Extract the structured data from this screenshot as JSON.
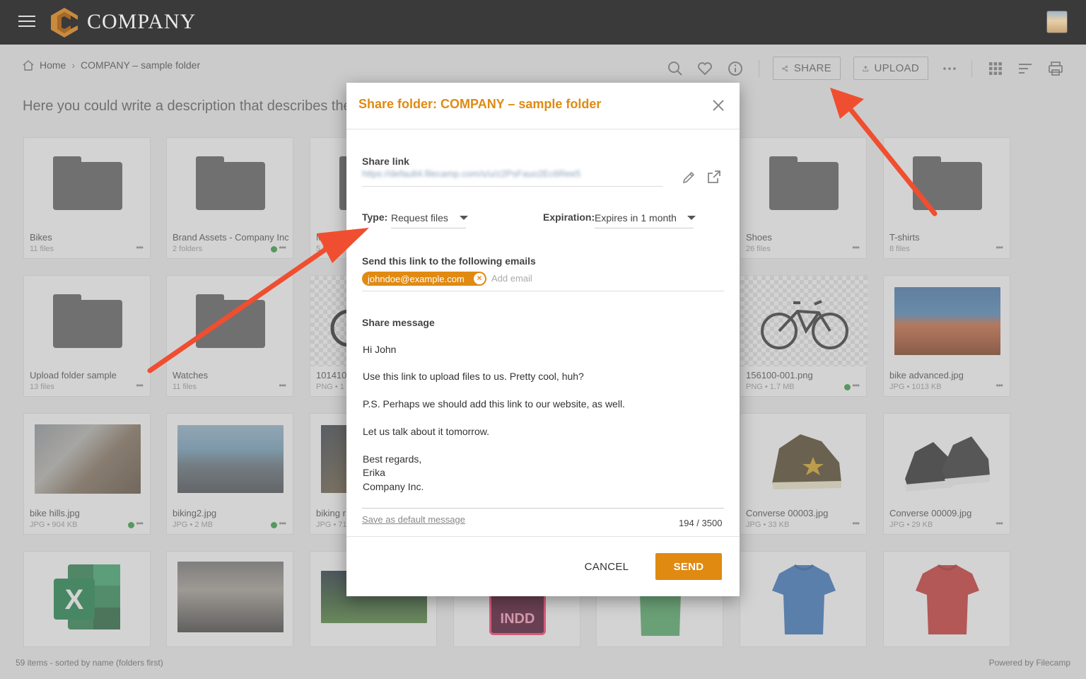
{
  "app": {
    "brand": "COMPANY"
  },
  "breadcrumb": {
    "home": "Home",
    "current": "COMPANY – sample folder"
  },
  "toolbar": {
    "share_label": "SHARE",
    "upload_label": "UPLOAD"
  },
  "description": "Here you could write a description that describes the c",
  "grid": {
    "items": [
      {
        "name": "Bikes",
        "meta": "11 files"
      },
      {
        "name": "Brand Assets - Company Inc.",
        "meta": "2 folders"
      },
      {
        "name": "Marke",
        "meta": "5 file"
      },
      {
        "name": "Shoes",
        "meta": "26 files"
      },
      {
        "name": "T-shirts",
        "meta": "8 files"
      },
      {
        "name": "Upload folder sample",
        "meta": "13 files"
      },
      {
        "name": "Watches",
        "meta": "11 files"
      },
      {
        "name": "101410",
        "meta": "PNG • 1"
      },
      {
        "name": "156100-001.png",
        "meta": "PNG • 1.7 MB"
      },
      {
        "name": "bike advanced.jpg",
        "meta": "JPG • 1013 KB"
      },
      {
        "name": "bike hills.jpg",
        "meta": "JPG • 904 KB"
      },
      {
        "name": "biking2.jpg",
        "meta": "JPG • 2 MB"
      },
      {
        "name": "biking r",
        "meta": "JPG • 71"
      },
      {
        "name": "Converse 00003.jpg",
        "meta": "JPG • 33 KB"
      },
      {
        "name": "Converse 00009.jpg",
        "meta": "JPG • 29 KB"
      },
      {
        "name": "",
        "meta": "",
        "badge": "INDD"
      },
      {
        "name": "",
        "meta": "",
        "badge": "X"
      }
    ]
  },
  "statusbar": {
    "left": "59 items - sorted by name (folders first)",
    "right": "Powered by Filecamp"
  },
  "dialog": {
    "title": "Share folder: COMPANY – sample folder",
    "share_link_label": "Share link",
    "share_link_value": "https://default4.filecamp.com/s/u/z2PsFauo2Ec6Ree5",
    "type_label": "Type:",
    "type_value": "Request files",
    "expiration_label": "Expiration:",
    "expiration_value": "Expires in 1 month",
    "emails_label": "Send this link to the following emails",
    "email_chip": "johndoe@example.com",
    "add_email_placeholder": "Add email",
    "message_label": "Share message",
    "message_lines": [
      "Hi John",
      "Use this link to upload files to us. Pretty cool, huh?",
      "P.S. Perhaps we should add this link to our website, as well.",
      "Let us talk about it tomorrow.",
      "Best regards,",
      "Erika",
      "Company Inc."
    ],
    "save_default_label": "Save as default message",
    "char_counter": "194 / 3500",
    "cancel_label": "CANCEL",
    "send_label": "SEND"
  },
  "colors": {
    "accent": "#e08a12",
    "topbar": "#3a3a3a",
    "arrow": "#f04e30",
    "status_dot": "#2a9a3a"
  }
}
